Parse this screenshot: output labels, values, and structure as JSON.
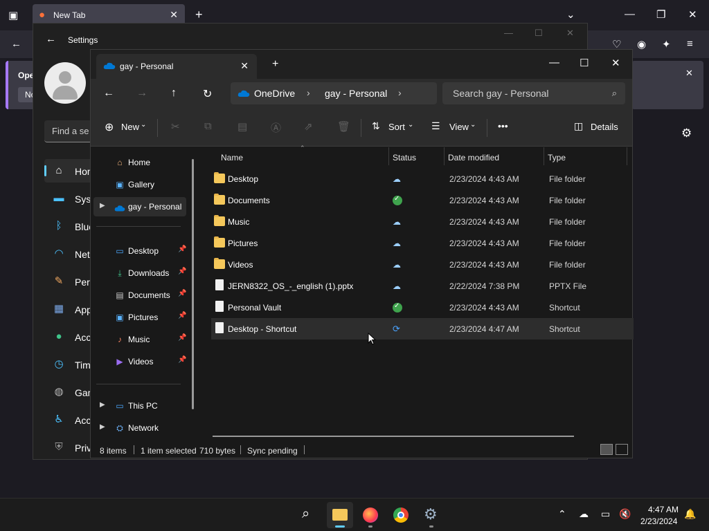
{
  "firefox": {
    "tab_title": "New Tab",
    "notice_heading": "Oper",
    "notice_button": "No"
  },
  "settings": {
    "title": "Settings",
    "search_placeholder": "Find a se",
    "nav": [
      {
        "label": "Hom",
        "icon": "home-icon"
      },
      {
        "label": "Syst",
        "icon": "monitor-icon"
      },
      {
        "label": "Blue",
        "icon": "bluetooth-icon"
      },
      {
        "label": "Net",
        "icon": "wifi-icon"
      },
      {
        "label": "Pers",
        "icon": "brush-icon"
      },
      {
        "label": "App",
        "icon": "apps-icon"
      },
      {
        "label": "Acc",
        "icon": "account-icon"
      },
      {
        "label": "Tim",
        "icon": "clock-icon"
      },
      {
        "label": "Gam",
        "icon": "gamepad-icon"
      },
      {
        "label": "Acc",
        "icon": "accessibility-icon"
      },
      {
        "label": "Priv",
        "icon": "shield-icon"
      }
    ]
  },
  "explorer": {
    "tab_title": "gay - Personal",
    "breadcrumb": [
      "OneDrive",
      "gay - Personal"
    ],
    "search_placeholder": "Search gay - Personal",
    "toolbar": {
      "new": "New",
      "sort": "Sort",
      "view": "View",
      "more": "•••",
      "details": "Details"
    },
    "nav_pane": [
      {
        "label": "Home",
        "icon": "home-icon"
      },
      {
        "label": "Gallery",
        "icon": "gallery-icon"
      },
      {
        "label": "gay - Personal",
        "icon": "onedrive-icon"
      },
      {
        "label": "Desktop",
        "icon": "desktop-icon"
      },
      {
        "label": "Downloads",
        "icon": "download-icon"
      },
      {
        "label": "Documents",
        "icon": "documents-icon"
      },
      {
        "label": "Pictures",
        "icon": "pictures-icon"
      },
      {
        "label": "Music",
        "icon": "music-icon"
      },
      {
        "label": "Videos",
        "icon": "videos-icon"
      },
      {
        "label": "This PC",
        "icon": "pc-icon"
      },
      {
        "label": "Network",
        "icon": "network-icon"
      }
    ],
    "columns": {
      "name": "Name",
      "status": "Status",
      "date": "Date modified",
      "type": "Type"
    },
    "rows": [
      {
        "name": "Desktop",
        "date": "2/23/2024 4:43 AM",
        "type": "File folder"
      },
      {
        "name": "Documents",
        "date": "2/23/2024 4:43 AM",
        "type": "File folder"
      },
      {
        "name": "Music",
        "date": "2/23/2024 4:43 AM",
        "type": "File folder"
      },
      {
        "name": "Pictures",
        "date": "2/23/2024 4:43 AM",
        "type": "File folder"
      },
      {
        "name": "Videos",
        "date": "2/23/2024 4:43 AM",
        "type": "File folder"
      },
      {
        "name": "JERN8322_OS_-_english (1).pptx",
        "date": "2/22/2024 7:38 PM",
        "type": "PPTX File"
      },
      {
        "name": "Personal Vault",
        "date": "2/23/2024 4:43 AM",
        "type": "Shortcut"
      },
      {
        "name": "Desktop - Shortcut",
        "date": "2/23/2024 4:47 AM",
        "type": "Shortcut"
      }
    ],
    "status_bar": {
      "items": "8 items",
      "selected": "1 item selected",
      "size": "710 bytes",
      "sync": "Sync pending"
    }
  },
  "taskbar": {
    "time": "4:47 AM",
    "date": "2/23/2024"
  }
}
